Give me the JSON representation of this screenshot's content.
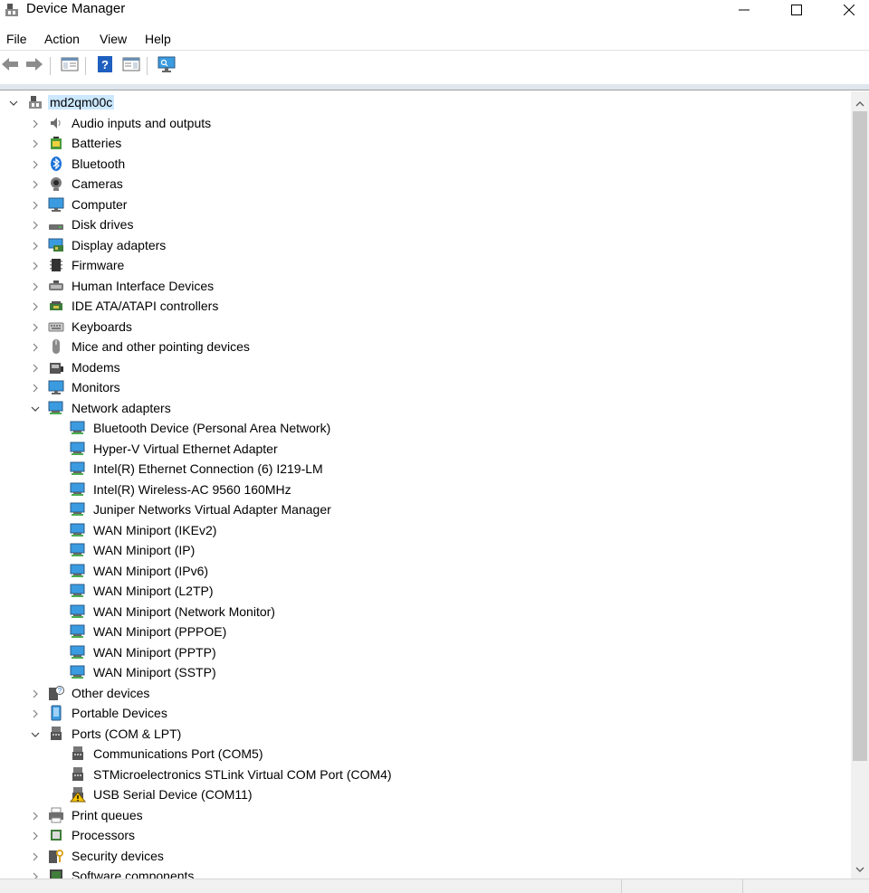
{
  "window": {
    "title": "Device Manager"
  },
  "menu": [
    "File",
    "Action",
    "View",
    "Help"
  ],
  "tree": {
    "root": "md2qm00c",
    "items": [
      {
        "label": "Audio inputs and outputs",
        "icon": "speaker-icon",
        "expanded": false
      },
      {
        "label": "Batteries",
        "icon": "battery-icon",
        "expanded": false
      },
      {
        "label": "Bluetooth",
        "icon": "bluetooth-icon",
        "expanded": false
      },
      {
        "label": "Cameras",
        "icon": "camera-icon",
        "expanded": false
      },
      {
        "label": "Computer",
        "icon": "computer-icon",
        "expanded": false
      },
      {
        "label": "Disk drives",
        "icon": "disk-drive-icon",
        "expanded": false
      },
      {
        "label": "Display adapters",
        "icon": "display-adapter-icon",
        "expanded": false
      },
      {
        "label": "Firmware",
        "icon": "firmware-icon",
        "expanded": false
      },
      {
        "label": "Human Interface Devices",
        "icon": "hid-icon",
        "expanded": false
      },
      {
        "label": "IDE ATA/ATAPI controllers",
        "icon": "ide-controller-icon",
        "expanded": false
      },
      {
        "label": "Keyboards",
        "icon": "keyboard-icon",
        "expanded": false
      },
      {
        "label": "Mice and other pointing devices",
        "icon": "mouse-icon",
        "expanded": false
      },
      {
        "label": "Modems",
        "icon": "modem-icon",
        "expanded": false
      },
      {
        "label": "Monitors",
        "icon": "monitor-icon",
        "expanded": false
      },
      {
        "label": "Network adapters",
        "icon": "network-adapter-icon",
        "expanded": true,
        "children": [
          {
            "label": "Bluetooth Device (Personal Area Network)",
            "icon": "network-adapter-icon"
          },
          {
            "label": "Hyper-V Virtual Ethernet Adapter",
            "icon": "network-adapter-icon"
          },
          {
            "label": "Intel(R) Ethernet Connection (6) I219-LM",
            "icon": "network-adapter-icon"
          },
          {
            "label": "Intel(R) Wireless-AC 9560 160MHz",
            "icon": "network-adapter-icon"
          },
          {
            "label": "Juniper Networks Virtual Adapter Manager",
            "icon": "network-adapter-icon"
          },
          {
            "label": "WAN Miniport (IKEv2)",
            "icon": "network-adapter-icon"
          },
          {
            "label": "WAN Miniport (IP)",
            "icon": "network-adapter-icon"
          },
          {
            "label": "WAN Miniport (IPv6)",
            "icon": "network-adapter-icon"
          },
          {
            "label": "WAN Miniport (L2TP)",
            "icon": "network-adapter-icon"
          },
          {
            "label": "WAN Miniport (Network Monitor)",
            "icon": "network-adapter-icon"
          },
          {
            "label": "WAN Miniport (PPPOE)",
            "icon": "network-adapter-icon"
          },
          {
            "label": "WAN Miniport (PPTP)",
            "icon": "network-adapter-icon"
          },
          {
            "label": "WAN Miniport (SSTP)",
            "icon": "network-adapter-icon"
          }
        ]
      },
      {
        "label": "Other devices",
        "icon": "unknown-device-icon",
        "expanded": false
      },
      {
        "label": "Portable Devices",
        "icon": "portable-device-icon",
        "expanded": false
      },
      {
        "label": "Ports (COM & LPT)",
        "icon": "port-icon",
        "expanded": true,
        "children": [
          {
            "label": "Communications Port (COM5)",
            "icon": "port-icon"
          },
          {
            "label": "STMicroelectronics STLink Virtual COM Port (COM4)",
            "icon": "port-icon"
          },
          {
            "label": "USB Serial Device (COM11)",
            "icon": "port-warning-icon"
          }
        ]
      },
      {
        "label": "Print queues",
        "icon": "printer-icon",
        "expanded": false
      },
      {
        "label": "Processors",
        "icon": "processor-icon",
        "expanded": false
      },
      {
        "label": "Security devices",
        "icon": "security-device-icon",
        "expanded": false
      },
      {
        "label": "Software components",
        "icon": "software-component-icon",
        "expanded": false
      }
    ]
  },
  "colors": {
    "selection": "#cce8ff",
    "accent": "#2b88d8"
  }
}
